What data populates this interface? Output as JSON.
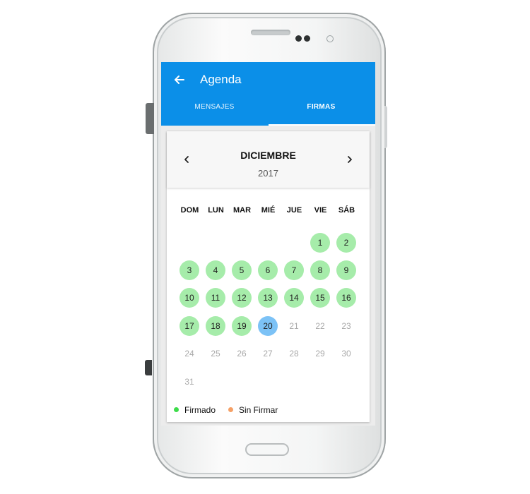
{
  "app": {
    "title": "Agenda"
  },
  "tabs": [
    {
      "label": "MENSAJES",
      "selected": false
    },
    {
      "label": "FIRMAS",
      "selected": true
    }
  ],
  "calendar": {
    "month": "DICIEMBRE",
    "year": "2017",
    "weekdays": [
      "DOM",
      "LUN",
      "MAR",
      "MIÉ",
      "JUE",
      "VIE",
      "SÁB"
    ],
    "days": [
      {
        "num": "1",
        "status": "signed"
      },
      {
        "num": "2",
        "status": "signed"
      },
      {
        "num": "3",
        "status": "signed"
      },
      {
        "num": "4",
        "status": "signed"
      },
      {
        "num": "5",
        "status": "signed"
      },
      {
        "num": "6",
        "status": "signed"
      },
      {
        "num": "7",
        "status": "signed"
      },
      {
        "num": "8",
        "status": "signed"
      },
      {
        "num": "9",
        "status": "signed"
      },
      {
        "num": "10",
        "status": "signed"
      },
      {
        "num": "11",
        "status": "signed"
      },
      {
        "num": "12",
        "status": "signed"
      },
      {
        "num": "13",
        "status": "signed"
      },
      {
        "num": "14",
        "status": "signed"
      },
      {
        "num": "15",
        "status": "signed"
      },
      {
        "num": "16",
        "status": "signed"
      },
      {
        "num": "17",
        "status": "signed"
      },
      {
        "num": "18",
        "status": "signed"
      },
      {
        "num": "19",
        "status": "signed"
      },
      {
        "num": "20",
        "status": "today"
      },
      {
        "num": "21",
        "status": "future"
      },
      {
        "num": "22",
        "status": "future"
      },
      {
        "num": "23",
        "status": "future"
      },
      {
        "num": "24",
        "status": "future"
      },
      {
        "num": "25",
        "status": "future"
      },
      {
        "num": "26",
        "status": "future"
      },
      {
        "num": "27",
        "status": "future"
      },
      {
        "num": "28",
        "status": "future"
      },
      {
        "num": "29",
        "status": "future"
      },
      {
        "num": "30",
        "status": "future"
      },
      {
        "num": "31",
        "status": "future"
      }
    ]
  },
  "legend": [
    {
      "label": "Firmado",
      "color": "#3ddc4a"
    },
    {
      "label": "Sin Firmar",
      "color": "#f5a066"
    }
  ],
  "colors": {
    "app_bar": "#0b8fe8",
    "signed_day": "#a6ecaa",
    "today": "#7cc2f6"
  },
  "icons": {
    "back": "arrow-left",
    "prev": "chevron-left",
    "next": "chevron-right"
  }
}
